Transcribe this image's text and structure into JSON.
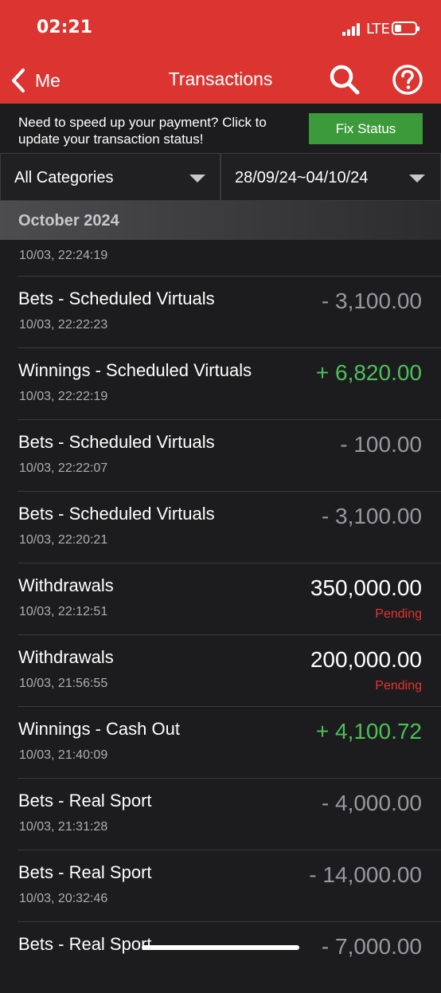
{
  "status_bar": {
    "time": "02:21",
    "network": "LTE"
  },
  "nav": {
    "back_label": "Me",
    "title": "Transactions"
  },
  "notice": {
    "text": "Need to speed up your payment? Click to update your transaction status!",
    "button_label": "Fix Status"
  },
  "filters": {
    "category": "All Categories",
    "date_range": "28/09/24~04/10/24"
  },
  "section": {
    "month": "October 2024"
  },
  "first_row_time": "10/03, 22:24:19",
  "transactions": [
    {
      "title": "Bets - Scheduled Virtuals",
      "time": "10/03, 22:22:23",
      "amount": "- 3,100.00",
      "kind": "neg",
      "status": ""
    },
    {
      "title": "Winnings - Scheduled Virtuals",
      "time": "10/03, 22:22:19",
      "amount": "+ 6,820.00",
      "kind": "pos",
      "status": ""
    },
    {
      "title": "Bets - Scheduled Virtuals",
      "time": "10/03, 22:22:07",
      "amount": "- 100.00",
      "kind": "neg",
      "status": ""
    },
    {
      "title": "Bets - Scheduled Virtuals",
      "time": "10/03, 22:20:21",
      "amount": "- 3,100.00",
      "kind": "neg",
      "status": ""
    },
    {
      "title": "Withdrawals",
      "time": "10/03, 22:12:51",
      "amount": "350,000.00",
      "kind": "neu",
      "status": "Pending"
    },
    {
      "title": "Withdrawals",
      "time": "10/03, 21:56:55",
      "amount": "200,000.00",
      "kind": "neu",
      "status": "Pending"
    },
    {
      "title": "Winnings - Cash Out",
      "time": "10/03, 21:40:09",
      "amount": "+ 4,100.72",
      "kind": "pos",
      "status": ""
    },
    {
      "title": "Bets - Real Sport",
      "time": "10/03, 21:31:28",
      "amount": "- 4,000.00",
      "kind": "neg",
      "status": ""
    },
    {
      "title": "Bets - Real Sport",
      "time": "10/03, 20:32:46",
      "amount": "- 14,000.00",
      "kind": "neg",
      "status": ""
    },
    {
      "title": "Bets - Real Sport",
      "time": "",
      "amount": "- 7,000.00",
      "kind": "neg",
      "status": ""
    }
  ],
  "colors": {
    "brand_red": "#dc3531",
    "fix_green": "#3d9a3b",
    "positive": "#4cc05a",
    "pending": "#e3342f",
    "background": "#1c1c1e"
  },
  "icons": [
    "chevron-left-icon",
    "search-icon",
    "help-icon",
    "caret-down-icon",
    "signal-icon",
    "battery-icon"
  ]
}
